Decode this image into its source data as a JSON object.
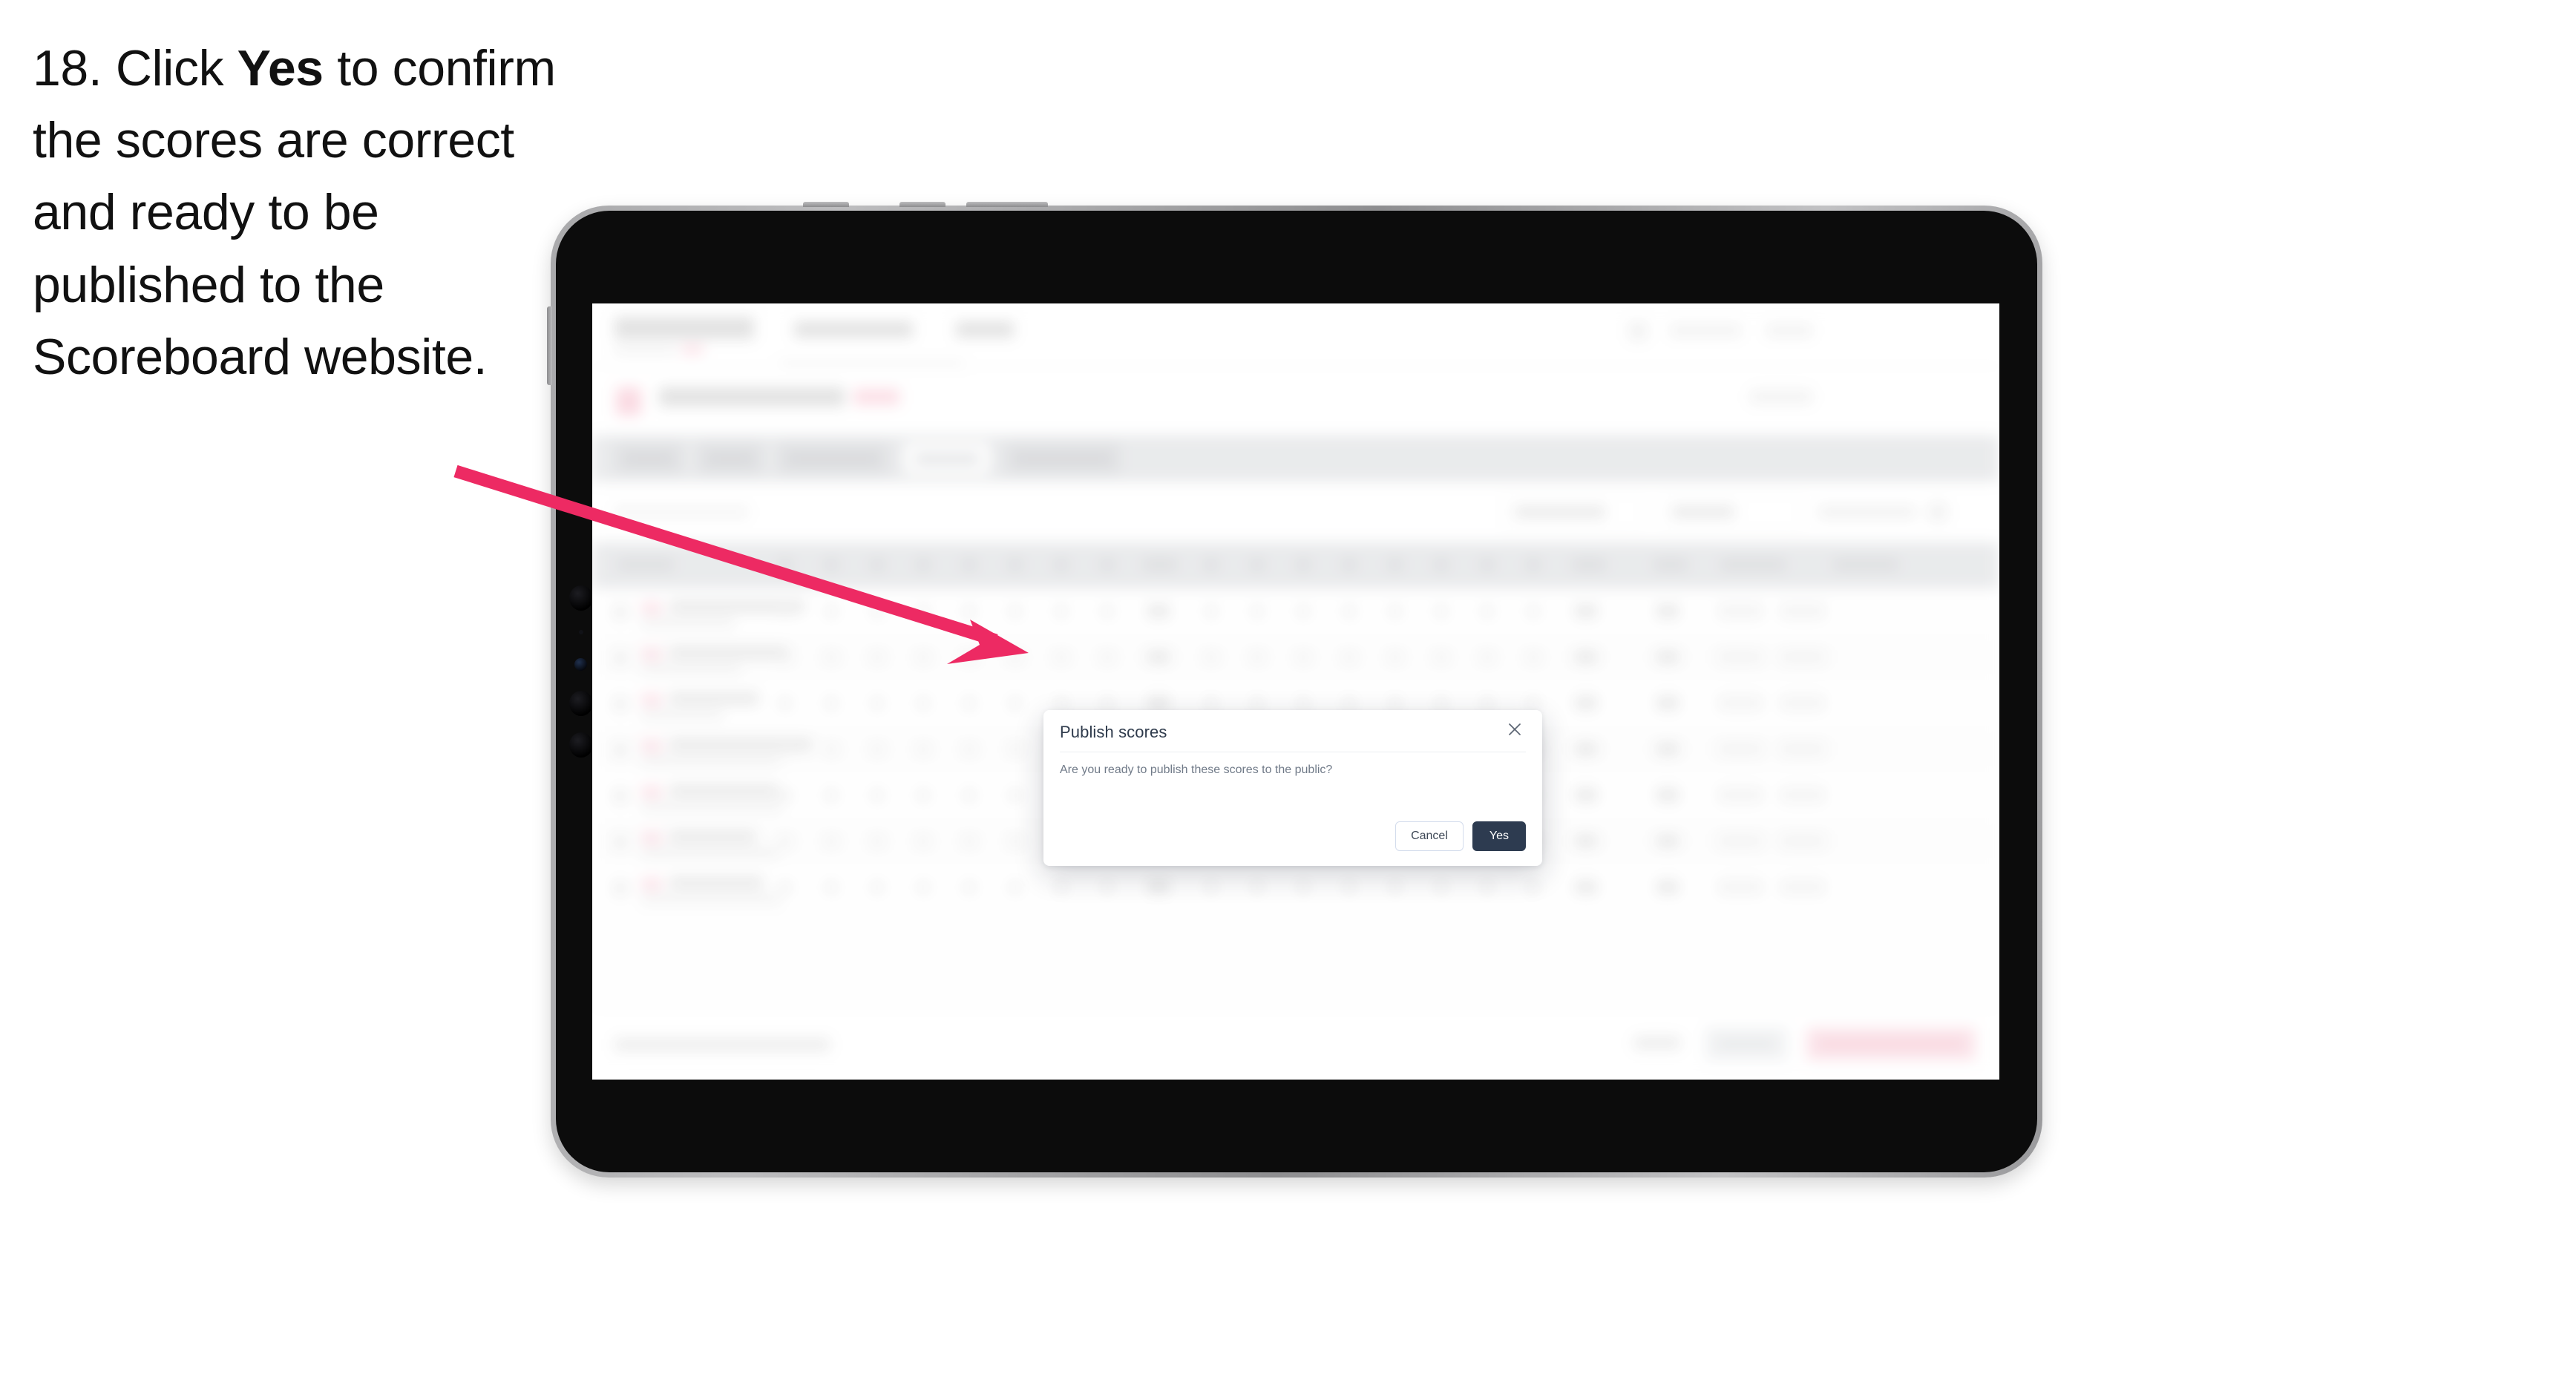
{
  "instruction": {
    "step_number": "18.",
    "lead": "Click ",
    "emphasis": "Yes",
    "rest": " to confirm the scores are correct and ready to be published to the Scoreboard website."
  },
  "dialog": {
    "title": "Publish scores",
    "body": "Are you ready to publish these scores to the public?",
    "cancel_label": "Cancel",
    "confirm_label": "Yes",
    "close_icon": "close-icon"
  },
  "device": {
    "type": "tablet",
    "orientation": "landscape",
    "body_color": "#0c0c0c",
    "rim_color": "#a9a9ab"
  },
  "colors": {
    "arrow": "#ED2A63",
    "confirm_button": "#2d3b50",
    "cancel_border": "#d3dcec",
    "dialog_title": "#2f3b4c",
    "dialog_body": "#707a88",
    "page_background": "#ffffff"
  },
  "background_app": {
    "state": "blurred",
    "description": "Scoreboard results table behind modal overlay"
  }
}
